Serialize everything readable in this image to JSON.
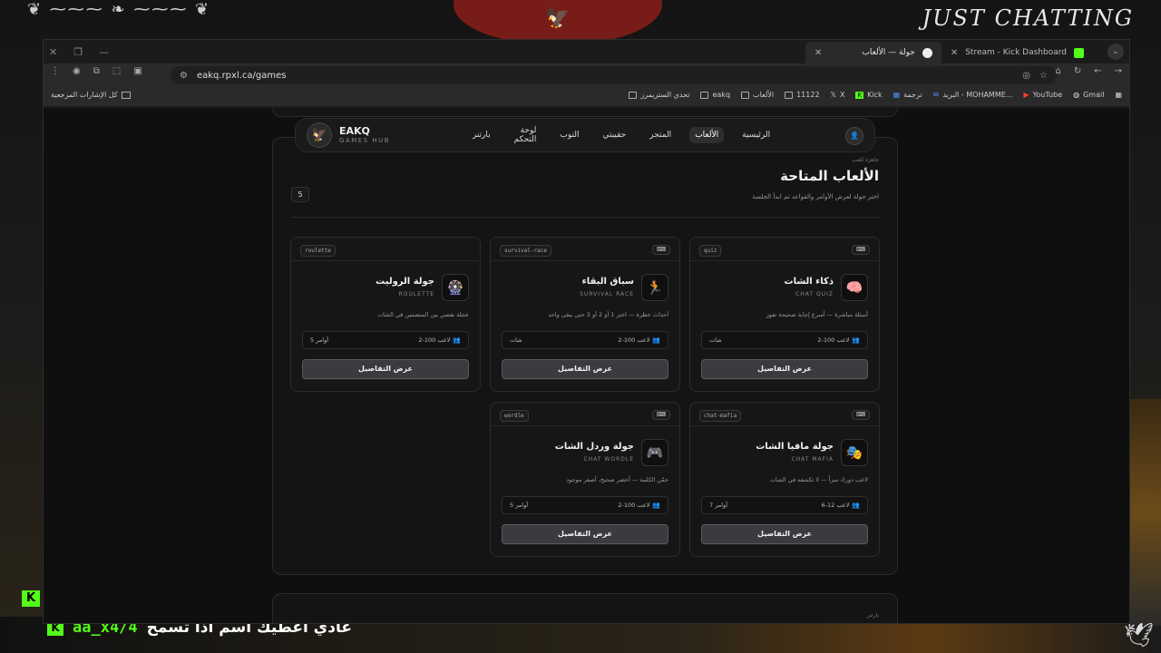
{
  "stream": {
    "overlay_title": "JUST CHATTING",
    "chat": {
      "user": "aa_x4/4",
      "message": "عادي اعطيك اسم اذا تسمح"
    }
  },
  "browser": {
    "tabs": [
      {
        "label": "جولة — الألعاب",
        "active": true
      },
      {
        "label": "Stream - Kick Dashboard",
        "active": false
      }
    ],
    "url": "eakq.rpxl.ca/games",
    "bookmarks": [
      "Gmail",
      "YouTube",
      "البريد - MOHAMME...",
      "ترجمة",
      "Kick",
      "X",
      "11122",
      "الألعاب",
      "eakq",
      "تحدي الستريمرز"
    ],
    "all_bookmarks": "كل الإشارات المرجعية"
  },
  "nav": {
    "logo_title": "EAKQ",
    "logo_sub": "GAMES HUB",
    "links": [
      "الرئيسية",
      "الألعاب",
      "المتجر",
      "حقيبتي",
      "التوب",
      "لوحة التحكم",
      "بارتنر"
    ],
    "active": "الألعاب"
  },
  "games": {
    "crumb": "جاهزة للعب",
    "title": "الألعاب المتاحة",
    "subtitle": "اختر جولة لعرض الأوامر والقواعد ثم ابدأ الجلسة",
    "count": "5",
    "items": [
      {
        "tag": "quiz",
        "ctl": "⌨",
        "icon": "🧠",
        "title": "ذكاء الشات",
        "en": "CHAT QUIZ",
        "desc": "أسئلة مباشرة — أسرع إجابة صحيحة تفوز",
        "players": "2-100 لاعب",
        "cmd": "شات",
        "button": "عرض التفاصيل"
      },
      {
        "tag": "survival-race",
        "ctl": "⌨",
        "icon": "🏃",
        "title": "سباق البقاء",
        "en": "SURVIVAL RACE",
        "desc": "أحداث خطرة — اختر 1 أو 2 أو 3 حتى يبقى واحد",
        "players": "2-100 لاعب",
        "cmd": "شات",
        "button": "عرض التفاصيل"
      },
      {
        "tag": "roulette",
        "ctl": "",
        "icon": "🎡",
        "title": "جولة الروليت",
        "en": "ROULETTE",
        "desc": "عجلة تقصي بين المنضمين في الشات",
        "players": "2-100 لاعب",
        "cmd": "5 أوامر",
        "button": "عرض التفاصيل"
      },
      {
        "tag": "chat-mafia",
        "ctl": "⌨",
        "icon": "🎭",
        "title": "جولة مافيا الشات",
        "en": "CHAT MAFIA",
        "desc": "لاعب دورك سراً — لا تكشفه في الشات",
        "players": "6-12 لاعب",
        "cmd": "7 أوامر",
        "button": "عرض التفاصيل"
      },
      {
        "tag": "wordle",
        "ctl": "⌨",
        "icon": "🎮",
        "title": "جولة وردل الشات",
        "en": "CHAT WORDLE",
        "desc": "خمّن الكلمة — أخضر صحيح، أصفر موجود",
        "players": "2-100 لاعب",
        "cmd": "5 أوامر",
        "button": "عرض التفاصيل"
      }
    ]
  },
  "partner_section": {
    "label": "بارتنر"
  },
  "colors": {
    "accent": "#53fc18",
    "button": "#3a3a3f",
    "player_icon": "#6b6bd8"
  }
}
